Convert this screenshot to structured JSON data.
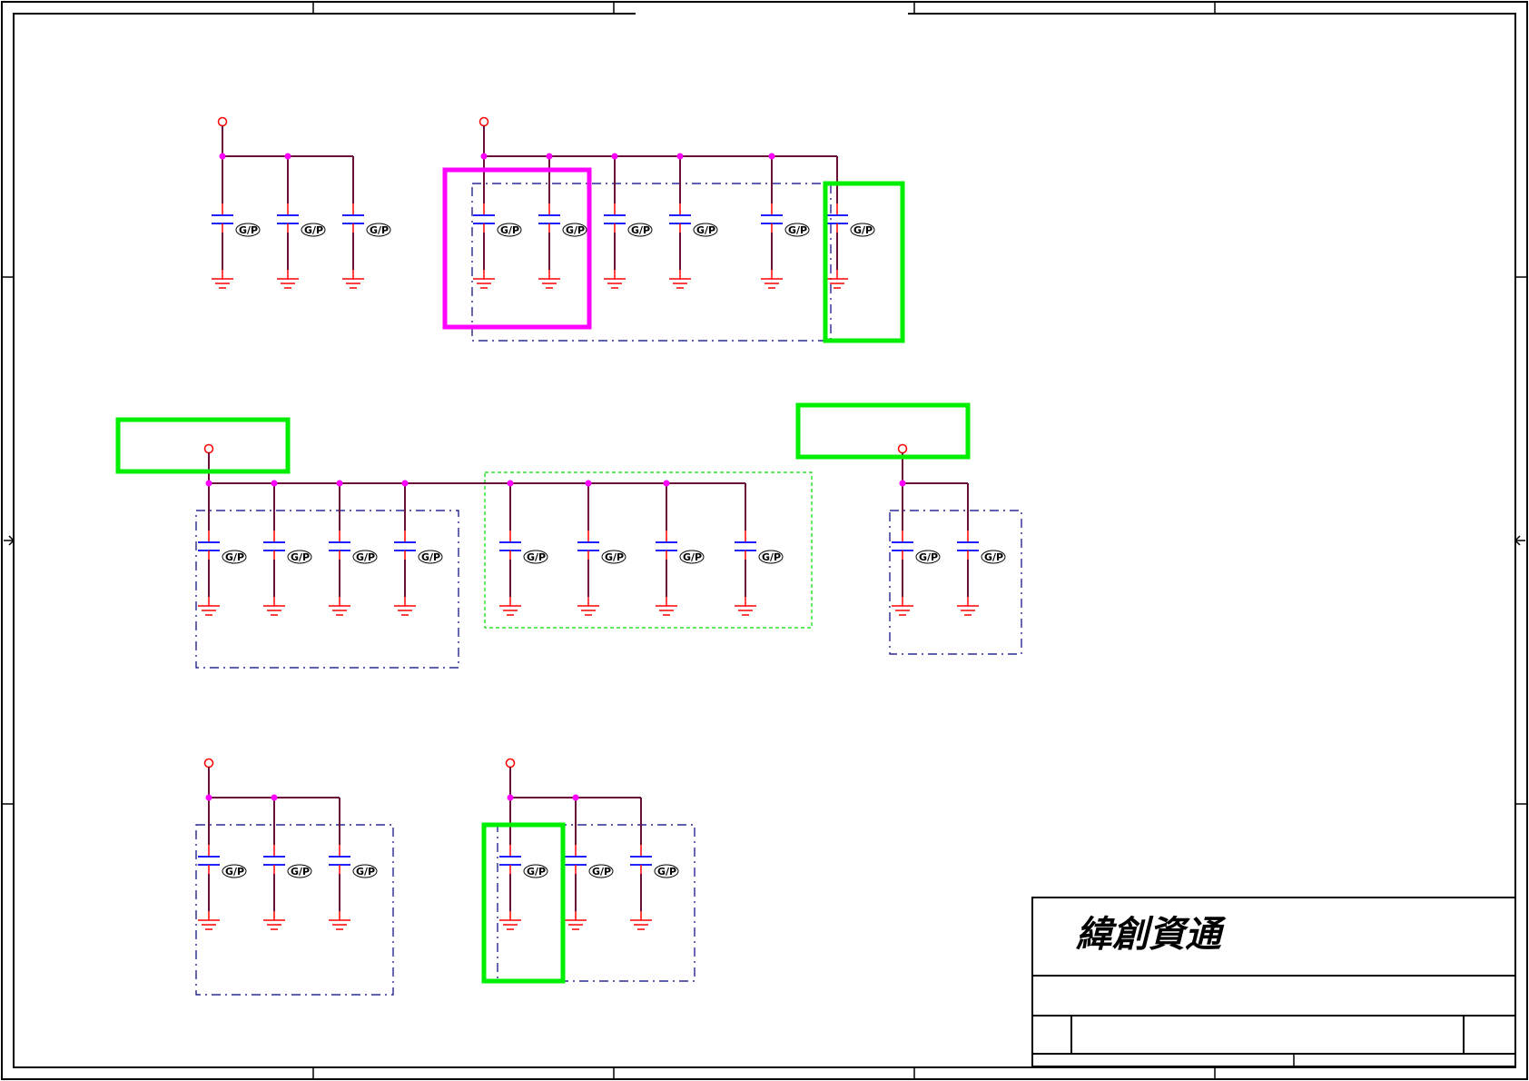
{
  "colors": {
    "frame": "#000000",
    "net": "#6b0f3a",
    "stub": "#ff0000",
    "junction": "#ff00ff",
    "cap": "#0000ff",
    "ground": "#ff0000",
    "group_outline": "#000080",
    "highlight_green": "#00ee00",
    "highlight_magenta": "#ff00ff",
    "group_outline_green": "#00dd00"
  },
  "title_block": {
    "company": "緯創資通"
  },
  "capacitor_label": "G/P",
  "circuits": [
    {
      "id": "grp-a",
      "cap_count": 3
    },
    {
      "id": "grp-b",
      "cap_count": 6
    },
    {
      "id": "grp-c",
      "cap_count": 8
    },
    {
      "id": "grp-d",
      "cap_count": 2
    },
    {
      "id": "grp-e",
      "cap_count": 3
    },
    {
      "id": "grp-f",
      "cap_count": 3
    }
  ],
  "highlights": [
    {
      "id": "magenta-box",
      "color": "magenta"
    },
    {
      "id": "green-box-1",
      "color": "green"
    },
    {
      "id": "green-box-2",
      "color": "green"
    },
    {
      "id": "green-box-3",
      "color": "green"
    },
    {
      "id": "green-box-4",
      "color": "green"
    }
  ]
}
